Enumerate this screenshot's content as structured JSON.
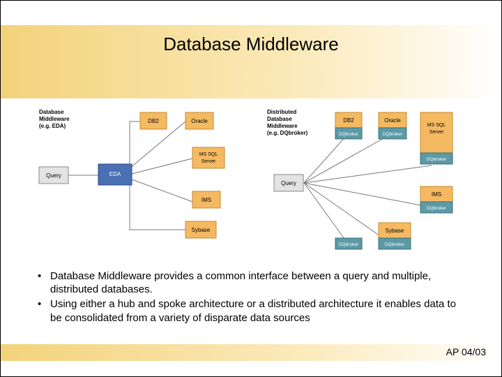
{
  "title": "Database Middleware",
  "diagramA": {
    "caption": [
      "Database",
      "Middleware",
      "(e.g. EDA)"
    ],
    "query": "Query",
    "hub": "EDA",
    "dbs": [
      "DB2",
      "Oracle",
      "MS SQL Server",
      "IMS",
      "Sybase"
    ]
  },
  "diagramB": {
    "caption": [
      "Distributed",
      "Database",
      "Middleware",
      "(e.g. DQbroker)"
    ],
    "query": "Query",
    "broker": "DQbroker",
    "dbs": [
      "DB2",
      "Oracle",
      "MS SQL Server",
      "IMS",
      "Sybase"
    ]
  },
  "bullets": [
    "Database Middleware provides a common interface between a query and multiple, distributed databases.",
    "Using either a hub and spoke architecture or a distributed architecture it enables data to be consolidated from a variety of disparate data sources"
  ],
  "footer": "AP 04/03",
  "colors": {
    "orange": "#f5b962",
    "orangeStroke": "#c48a2e",
    "blue": "#4a6fb3",
    "blueStroke": "#2d4a82",
    "teal": "#5c9aa6",
    "tealStroke": "#3d6e78",
    "gray": "#e3e3e3",
    "grayStroke": "#8a8a8a"
  }
}
